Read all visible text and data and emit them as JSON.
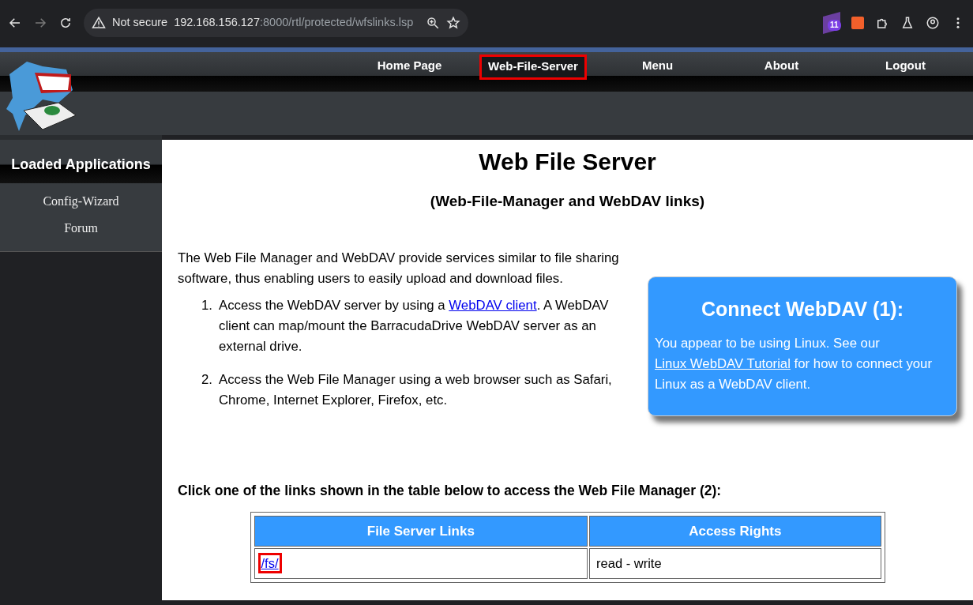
{
  "browser": {
    "security": "Not secure",
    "url_host": "192.168.156.127",
    "url_rest": ":8000/rtl/protected/wfslinks.lsp",
    "extension_badge": "11"
  },
  "nav": [
    {
      "label": "Home Page",
      "highlighted": false
    },
    {
      "label": "Web-File-Server",
      "highlighted": true
    },
    {
      "label": "Menu",
      "highlighted": false
    },
    {
      "label": "About",
      "highlighted": false
    },
    {
      "label": "Logout",
      "highlighted": false
    }
  ],
  "sidebar": {
    "title": "Loaded Applications",
    "items": [
      "Config-Wizard",
      "Forum"
    ]
  },
  "main": {
    "title": "Web File Server",
    "subtitle": "(Web-File-Manager and WebDAV links)",
    "intro": "The Web File Manager and WebDAV provide services similar to file sharing software, thus enabling users to easily upload and download files.",
    "steps": [
      {
        "marker": "1.",
        "before": "Access the WebDAV server by using a ",
        "link": "WebDAV client",
        "after": ". A WebDAV client can map/mount the BarracudaDrive WebDAV server as an external drive."
      },
      {
        "marker": "2.",
        "before": "Access the Web File Manager using a web browser such as Safari, Chrome, Internet Explorer, Firefox, etc."
      }
    ],
    "connect": {
      "title": "Connect WebDAV (1):",
      "before": "You appear to be using Linux. See our ",
      "link": "Linux WebDAV Tutorial",
      "after": " for how to connect your Linux as a WebDAV client."
    },
    "table_caption": "Click one of the links shown in the table below to access the Web File Manager (2):",
    "table": {
      "columns": [
        "File Server Links",
        "Access Rights"
      ],
      "rows": [
        {
          "link": "/fs/",
          "highlighted": true,
          "rights": "read - write"
        }
      ]
    }
  }
}
